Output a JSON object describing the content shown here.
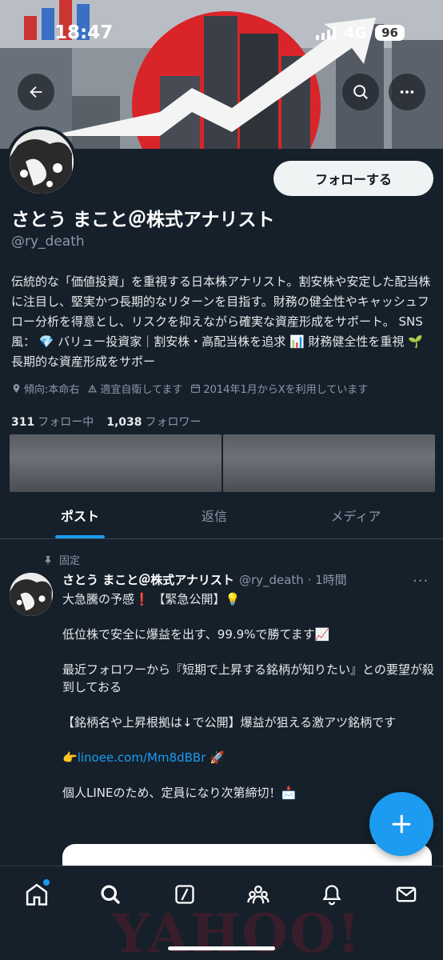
{
  "status_bar": {
    "time": "18:47",
    "network": "4G",
    "battery": "96"
  },
  "banner": {
    "colors": {
      "sun": "#d9252a",
      "arrow": "#f4f4f4",
      "sky": "#8e949c"
    }
  },
  "header": {
    "back_icon": "arrow-left-icon",
    "search_icon": "search-icon",
    "more_icon": "more-horizontal-icon"
  },
  "profile": {
    "follow_label": "フォローする",
    "display_name": "さとう まこと＠株式アナリスト",
    "handle": "@ry_death",
    "bio": "伝統的な「価値投資」を重視する日本株アナリスト。割安株や安定した配当株に注目し、堅実かつ長期的なリターンを目指す。財務の健全性やキャッシュフロー分析を得意とし、リスクを抑えながら確実な資産形成をサポート。 SNS風： 💎 バリュー投資家｜割安株・高配当株を追求 📊 財務健全性を重視 🌱 長期的な資産形成をサポー",
    "meta": {
      "location": "傾向:本命右",
      "note": "適宜自衛してます",
      "joined": "2014年1月からXを利用しています"
    },
    "following_count": "311",
    "following_label": "フォロー中",
    "followers_count": "1,038",
    "followers_label": "フォロワー"
  },
  "tabs": [
    {
      "label": "ポスト",
      "active": true
    },
    {
      "label": "返信",
      "active": false
    },
    {
      "label": "メディア",
      "active": false
    }
  ],
  "tweet": {
    "pinned_label": "固定",
    "author_name": "さとう まこと＠株式アナリスト",
    "author_handle": "@ry_death · 1時間",
    "more": "···",
    "lines": {
      "l1": "大急騰の予感❗ 【緊急公開】💡",
      "l2": "低位株で安全に爆益を出す、99.9%で勝てます📈",
      "l3": "最近フォロワーから『短期で上昇する銘柄が知りたい』との要望が殺到しておる",
      "l4": "【銘柄名や上昇根拠は↓で公開】爆益が狙える激アツ銘柄です",
      "l5_prefix": "👉",
      "l5_link": "linoee.com/Mm8dBBr",
      "l5_suffix": " 🚀",
      "l6": "個人LINEのため、定員になり次第締切！📩"
    }
  },
  "fab": {
    "icon": "plus-icon"
  },
  "bottom_nav": {
    "items": [
      "home-icon",
      "search-icon",
      "grok-icon",
      "communities-icon",
      "notifications-icon",
      "messages-icon"
    ],
    "ghost_text": "YAHOO!"
  }
}
